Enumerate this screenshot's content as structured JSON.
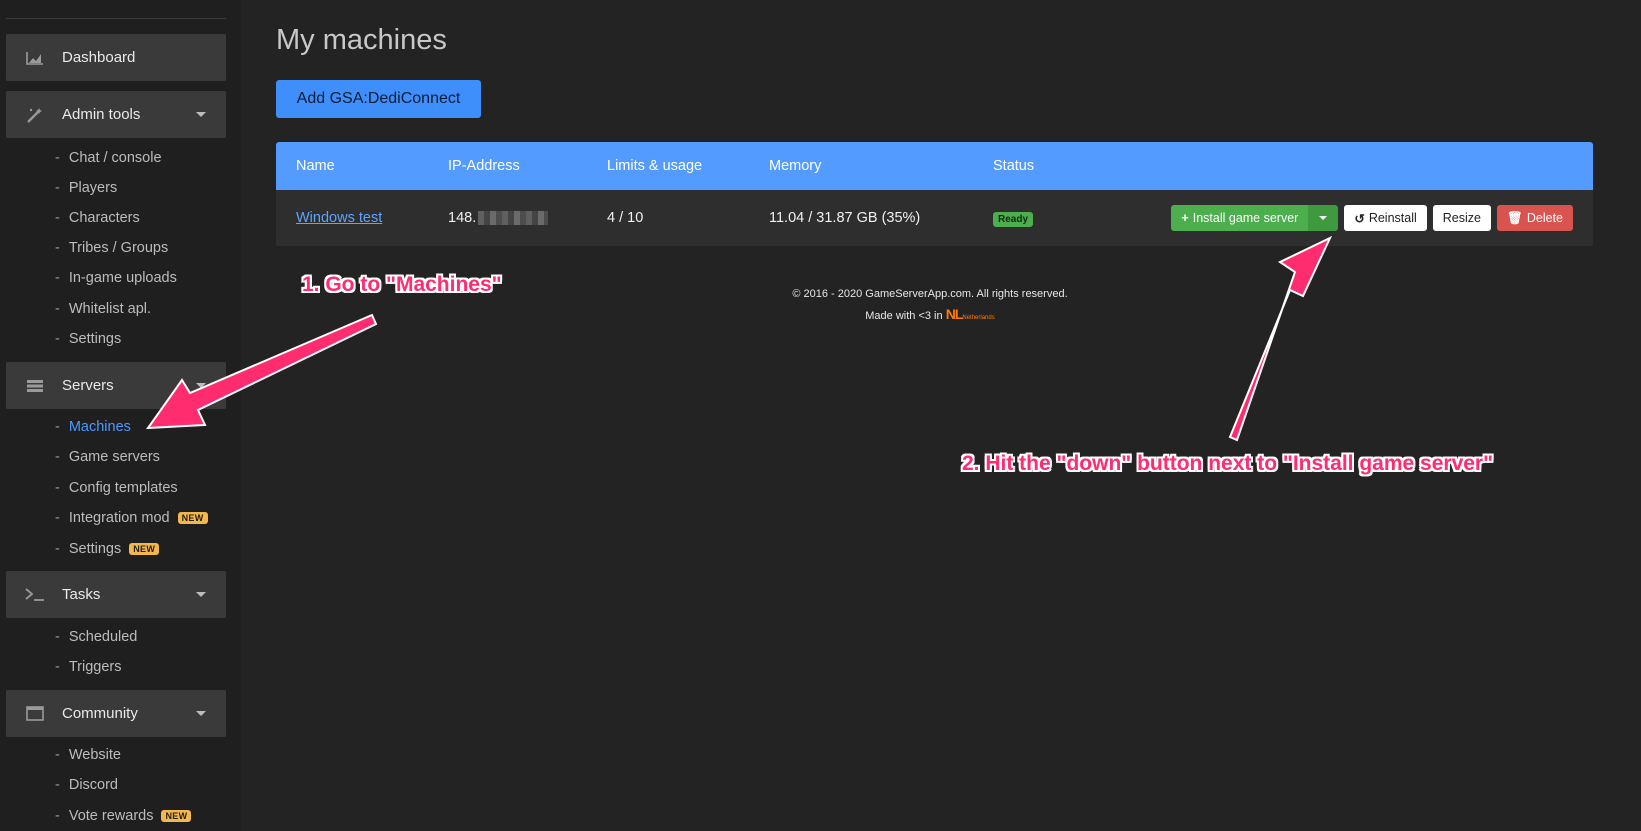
{
  "sidebar": {
    "sections": [
      {
        "label": "Dashboard",
        "icon": "chart-icon"
      },
      {
        "label": "Admin tools",
        "icon": "wand-icon",
        "items": [
          "Chat / console",
          "Players",
          "Characters",
          "Tribes / Groups",
          "In-game uploads",
          "Whitelist apl.",
          "Settings"
        ]
      },
      {
        "label": "Servers",
        "icon": "server-icon",
        "items": [
          "Machines",
          "Game servers",
          "Config templates",
          "Integration mod",
          "Settings"
        ]
      },
      {
        "label": "Tasks",
        "icon": "terminal-icon",
        "items": [
          "Scheduled",
          "Triggers"
        ]
      },
      {
        "label": "Community",
        "icon": "window-icon",
        "items": [
          "Website",
          "Discord",
          "Vote rewards"
        ]
      }
    ],
    "new_badge": "NEW",
    "active_item": "Machines"
  },
  "main": {
    "title": "My machines",
    "add_button": "Add GSA:DediConnect"
  },
  "table": {
    "headers": [
      "Name",
      "IP-Address",
      "Limits & usage",
      "Memory",
      "Status"
    ],
    "rows": [
      {
        "name": "Windows test",
        "ip_visible": "148.",
        "limits": "4 / 10",
        "memory": "11.04 / 31.87 GB (35%)",
        "status": "Ready"
      }
    ],
    "actions": {
      "install": "Install game server",
      "reinstall": "Reinstall",
      "resize": "Resize",
      "delete": "Delete"
    }
  },
  "footer": {
    "copyright": "© 2016 - 2020 GameServerApp.com. All rights reserved.",
    "made_with": "Made with <3 in",
    "logo": "NL",
    "logo_sub": "Netherlands"
  },
  "annotations": {
    "step1": "1. Go to \"Machines\"",
    "step2": "2. Hit the \"down\" button next to \"Install game server\""
  },
  "colors": {
    "accent": "#549bff",
    "annotation": "#ff2d6f",
    "success": "#4cae4c",
    "danger": "#d9534f",
    "badge": "#f5b64b"
  }
}
